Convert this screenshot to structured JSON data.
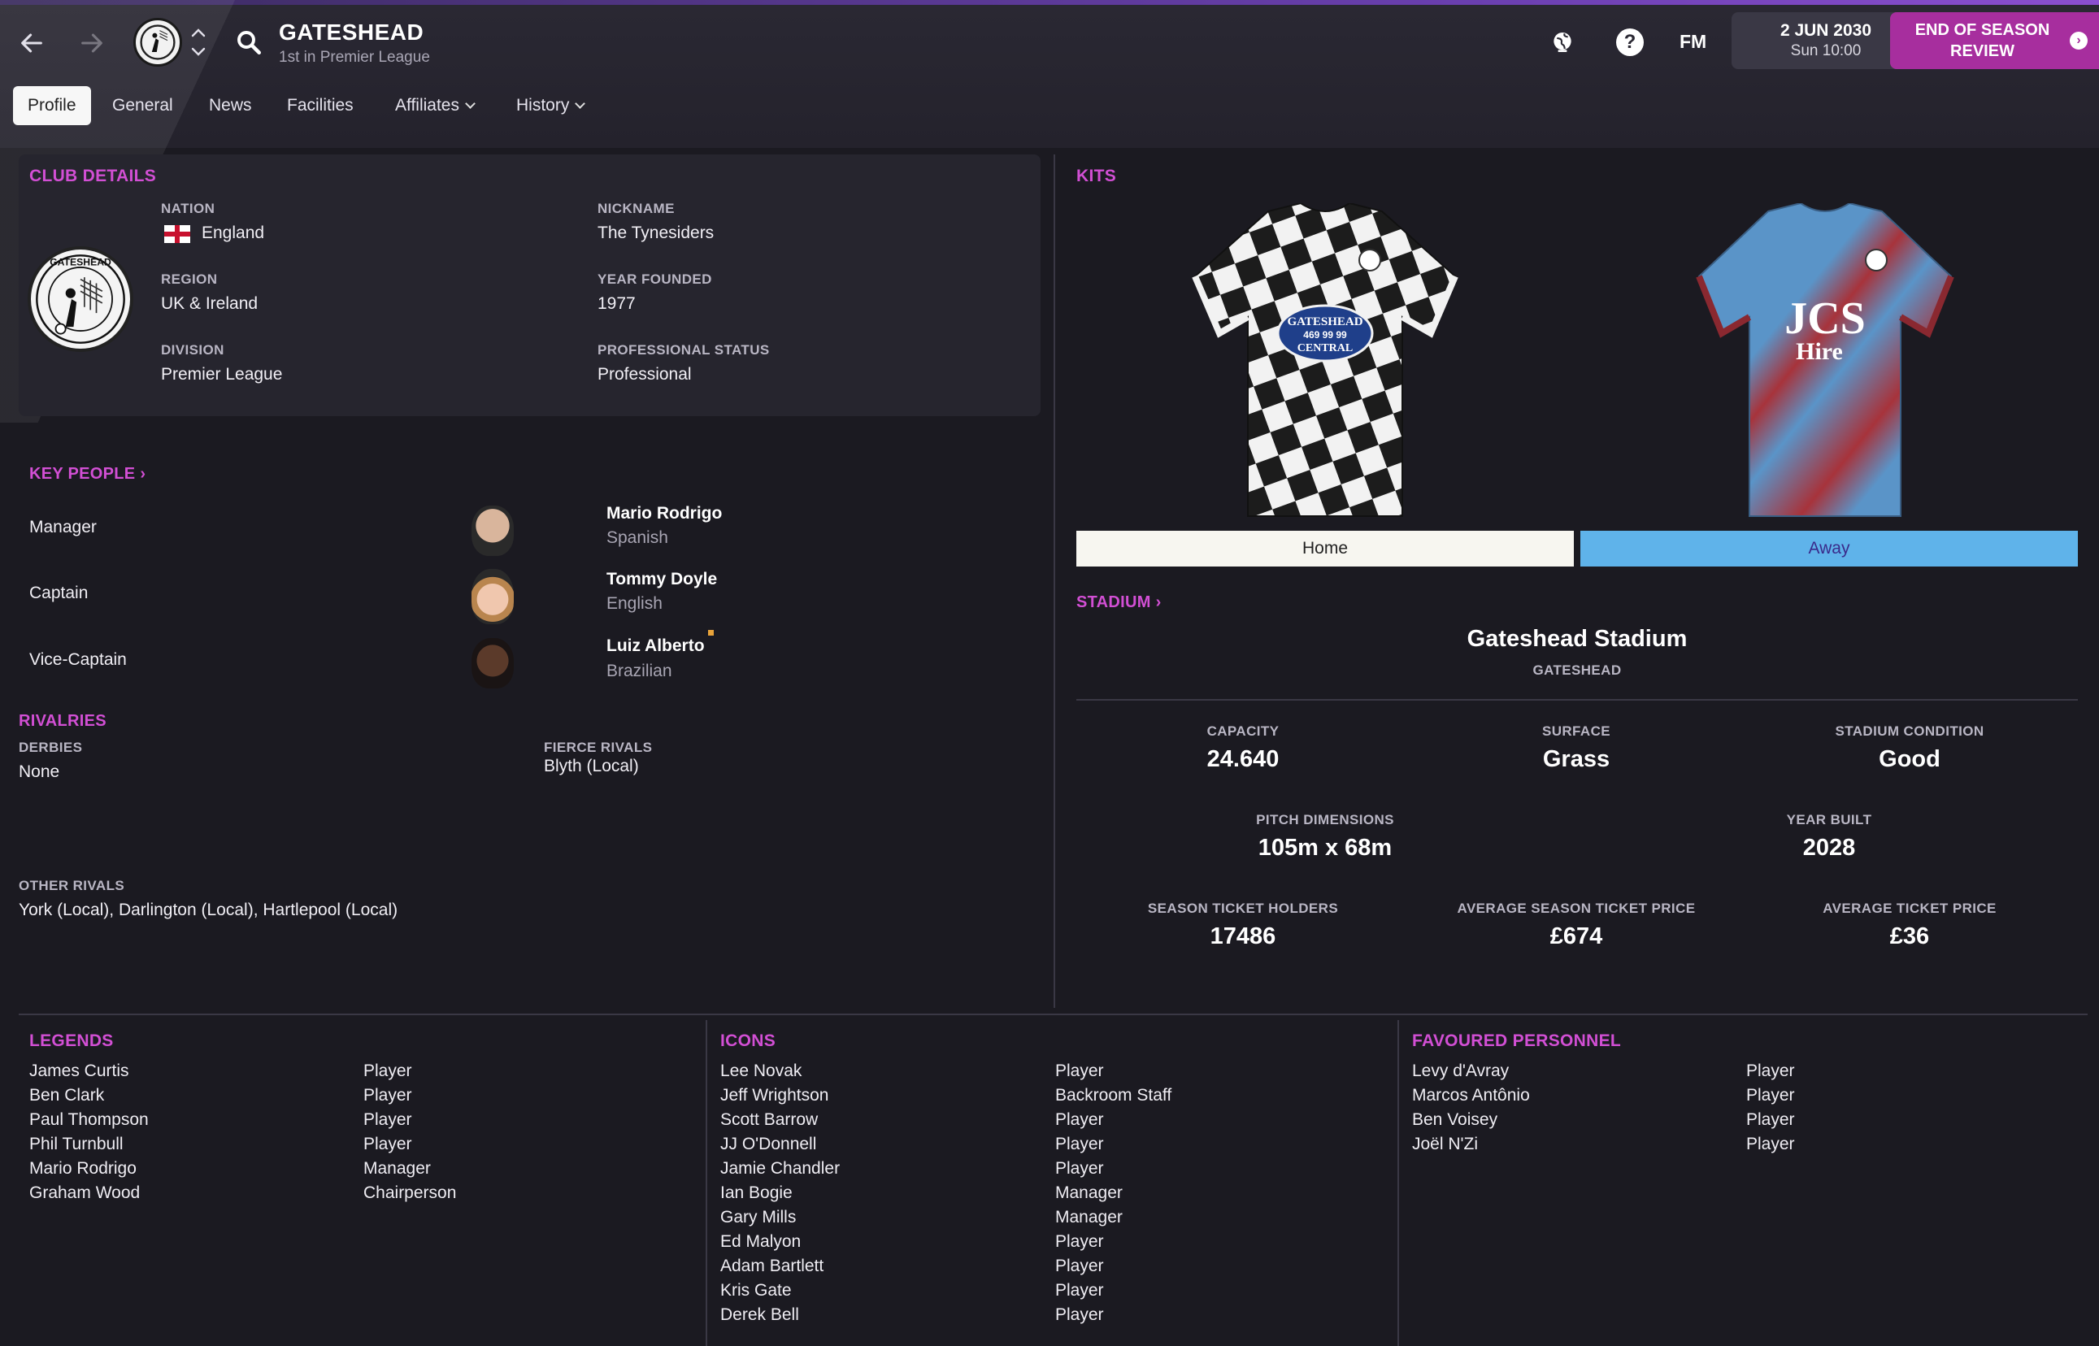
{
  "header": {
    "club_name": "GATESHEAD",
    "club_position": "1st in Premier League",
    "fm_label": "FM",
    "help_label": "?",
    "date": "2 JUN 2030",
    "time": "Sun 10:00",
    "action_button": "END OF SEASON REVIEW",
    "icons": [
      "back-arrow-icon",
      "forward-arrow-icon",
      "club-crest",
      "up-down-chevron-icon",
      "search-icon",
      "globe-icon",
      "help-icon",
      "fm-icon",
      "continue-icon"
    ]
  },
  "tabs": [
    {
      "label": "Profile",
      "active": true
    },
    {
      "label": "General"
    },
    {
      "label": "News"
    },
    {
      "label": "Facilities"
    },
    {
      "label": "Affiliates",
      "dropdown": true
    },
    {
      "label": "History",
      "dropdown": true
    }
  ],
  "club_details": {
    "section_title": "CLUB DETAILS",
    "nation_label": "NATION",
    "nation": "England",
    "nickname_label": "NICKNAME",
    "nickname": "The Tynesiders",
    "region_label": "REGION",
    "region": "UK & Ireland",
    "year_founded_label": "YEAR FOUNDED",
    "year_founded": "1977",
    "division_label": "DIVISION",
    "division": "Premier League",
    "status_label": "PROFESSIONAL STATUS",
    "status": "Professional"
  },
  "key_people": {
    "section_title": "KEY PEOPLE",
    "people": [
      {
        "role": "Manager",
        "name": "Mario Rodrigo",
        "nationality": "Spanish"
      },
      {
        "role": "Captain",
        "name": "Tommy Doyle",
        "nationality": "English"
      },
      {
        "role": "Vice-Captain",
        "name": "Luiz Alberto",
        "nationality": "Brazilian"
      }
    ]
  },
  "rivalries": {
    "section_title": "RIVALRIES",
    "derbies_label": "DERBIES",
    "derbies": "None",
    "fierce_label": "FIERCE RIVALS",
    "fierce": "Blyth (Local)",
    "other_label": "OTHER RIVALS",
    "other": "York (Local), Darlington (Local), Hartlepool (Local)"
  },
  "kits": {
    "section_title": "KITS",
    "home_label": "Home",
    "away_label": "Away",
    "home_sponsor_lines": [
      "GATESHEAD",
      "469 99 99",
      "CENTRAL"
    ],
    "away_sponsor_lines": [
      "JCS",
      "Hire"
    ],
    "colors": {
      "home_primary": "#f2f2f2",
      "home_secondary": "#1c1c1c",
      "away_primary": "#5a94c8",
      "away_accent": "#a7333b",
      "away_tab_bg": "#5fb3ea"
    }
  },
  "stadium": {
    "section_title": "STADIUM",
    "name": "Gateshead Stadium",
    "city": "GATESHEAD",
    "capacity_label": "CAPACITY",
    "capacity": "24.640",
    "surface_label": "SURFACE",
    "surface": "Grass",
    "condition_label": "STADIUM CONDITION",
    "condition": "Good",
    "pitch_label": "PITCH DIMENSIONS",
    "pitch": "105m x 68m",
    "built_label": "YEAR BUILT",
    "built": "2028",
    "sth_label": "SEASON TICKET HOLDERS",
    "sth": "17486",
    "astp_label": "AVERAGE SEASON TICKET PRICE",
    "astp": "£674",
    "atp_label": "AVERAGE TICKET PRICE",
    "atp": "£36"
  },
  "legends": {
    "section_title": "LEGENDS",
    "items": [
      {
        "name": "James Curtis",
        "type": "Player"
      },
      {
        "name": "Ben Clark",
        "type": "Player"
      },
      {
        "name": "Paul Thompson",
        "type": "Player"
      },
      {
        "name": "Phil Turnbull",
        "type": "Player"
      },
      {
        "name": "Mario Rodrigo",
        "type": "Manager"
      },
      {
        "name": "Graham Wood",
        "type": "Chairperson"
      }
    ]
  },
  "icons_list": {
    "section_title": "ICONS",
    "items": [
      {
        "name": "Lee Novak",
        "type": "Player"
      },
      {
        "name": "Jeff Wrightson",
        "type": "Backroom Staff"
      },
      {
        "name": "Scott Barrow",
        "type": "Player"
      },
      {
        "name": "JJ O'Donnell",
        "type": "Player"
      },
      {
        "name": "Jamie Chandler",
        "type": "Player"
      },
      {
        "name": "Ian Bogie",
        "type": "Manager"
      },
      {
        "name": "Gary Mills",
        "type": "Manager"
      },
      {
        "name": "Ed Malyon",
        "type": "Player"
      },
      {
        "name": "Adam Bartlett",
        "type": "Player"
      },
      {
        "name": "Kris Gate",
        "type": "Player"
      },
      {
        "name": "Derek Bell",
        "type": "Player"
      }
    ]
  },
  "favoured": {
    "section_title": "FAVOURED PERSONNEL",
    "items": [
      {
        "name": "Levy d'Avray",
        "type": "Player"
      },
      {
        "name": "Marcos Antônio",
        "type": "Player"
      },
      {
        "name": "Ben Voisey",
        "type": "Player"
      },
      {
        "name": "Joël N'Zi",
        "type": "Player"
      }
    ]
  }
}
